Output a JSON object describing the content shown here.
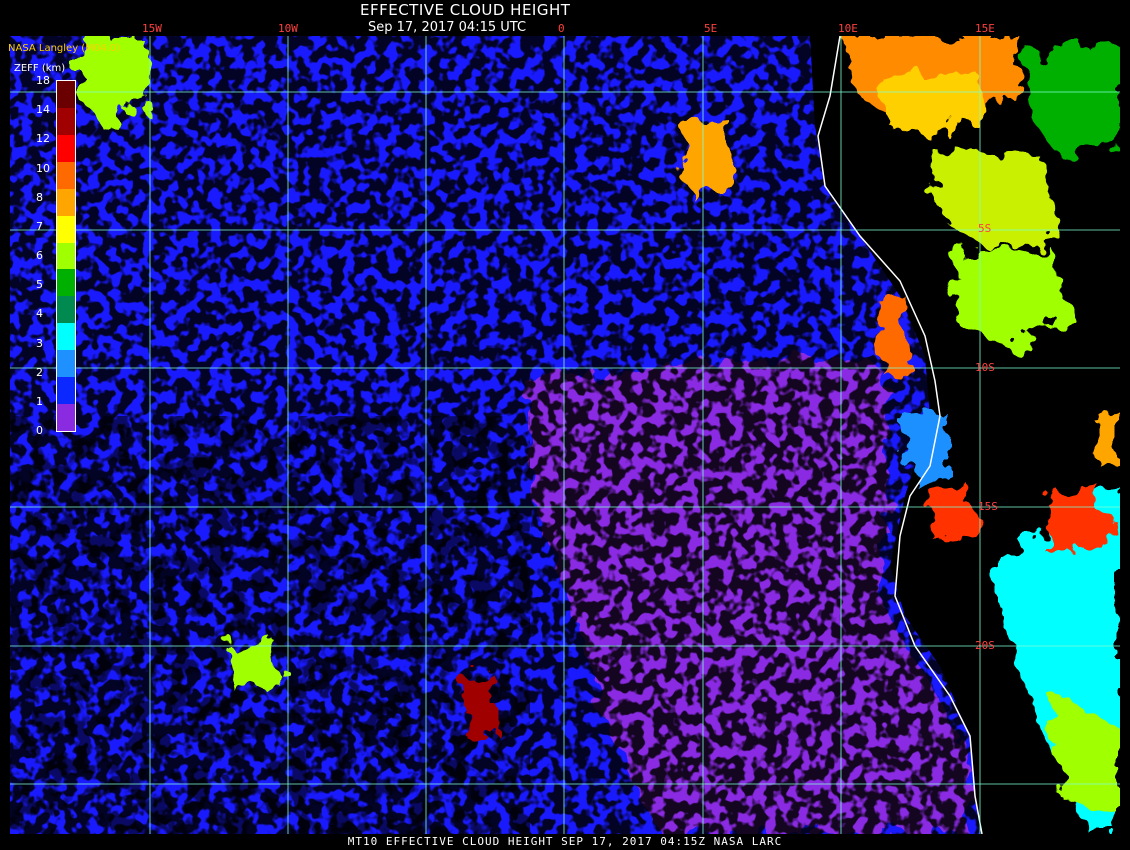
{
  "header": {
    "title": "EFFECTIVE CLOUD HEIGHT",
    "subtitle": "Sep 17, 2017 04:15 UTC",
    "agency": "NASA Langley (M04.0)"
  },
  "legend": {
    "title": "ZEFF (km)",
    "ticks": [
      "18",
      "14",
      "12",
      "10",
      "8",
      "7",
      "6",
      "5",
      "4",
      "3",
      "2",
      "1",
      "0"
    ],
    "colors": [
      "#6a0000",
      "#a00000",
      "#ff0000",
      "#ff6a00",
      "#ffa500",
      "#ffff00",
      "#a0ff00",
      "#00b000",
      "#008a50",
      "#00ffff",
      "#1e90ff",
      "#0a28ff",
      "#8a2be2"
    ]
  },
  "grid": {
    "lon_labels": [
      "15W",
      "10W",
      "0",
      "5E",
      "10E",
      "15E"
    ],
    "lat_labels": [
      "5S",
      "10S",
      "15S",
      "20S"
    ],
    "line_color": "#7fffd4",
    "label_color": "#ff2020"
  },
  "footer": {
    "text": "MT10  EFFECTIVE CLOUD HEIGHT   SEP 17, 2017 04:15Z   NASA LARC"
  },
  "palette": {
    "ocean_low": "#1a1aff",
    "clear": "#000000",
    "low_purple": "#8a2be2",
    "coast": "#ffffff"
  }
}
